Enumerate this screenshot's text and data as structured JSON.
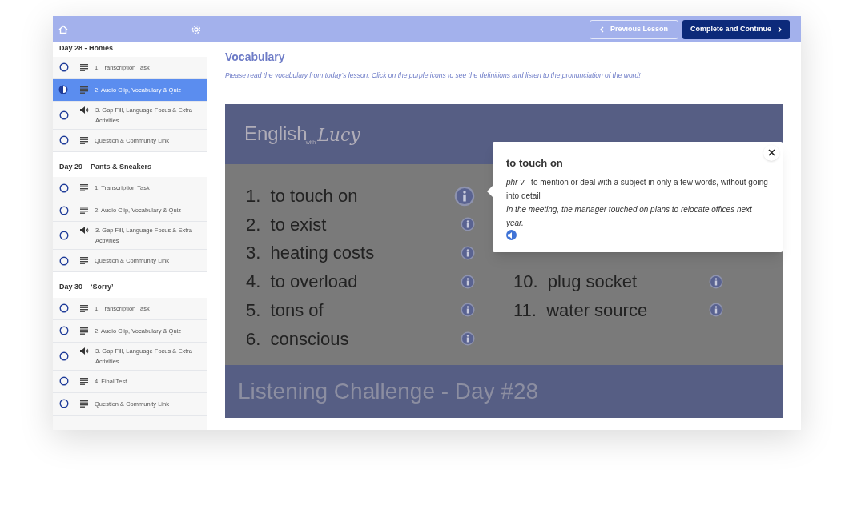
{
  "sections": [
    {
      "title": "Day 28 - Homes",
      "lessons": [
        {
          "label": "1. Transcription Task",
          "kind": "text",
          "level": 0,
          "selected": false
        },
        {
          "label": "2. Audio Clip, Vocabulary & Quiz",
          "kind": "text",
          "level": 0.5,
          "selected": true
        },
        {
          "label": "3. Gap Fill, Language Focus & Extra Activities",
          "kind": "audio",
          "level": 0,
          "selected": false
        },
        {
          "label": "Question & Community Link",
          "kind": "text",
          "level": 0,
          "selected": false
        }
      ]
    },
    {
      "title": "Day 29 – Pants & Sneakers",
      "lessons": [
        {
          "label": "1. Transcription Task",
          "kind": "text",
          "level": 0,
          "selected": false
        },
        {
          "label": "2. Audio Clip, Vocabulary & Quiz",
          "kind": "text",
          "level": 0,
          "selected": false
        },
        {
          "label": "3. Gap Fill, Language Focus & Extra Activities",
          "kind": "audio",
          "level": 0,
          "selected": false
        },
        {
          "label": "Question & Community Link",
          "kind": "text",
          "level": 0,
          "selected": false
        }
      ]
    },
    {
      "title": "Day 30 – ‘Sorry’",
      "lessons": [
        {
          "label": "1. Transcription Task",
          "kind": "text",
          "level": 0,
          "selected": false
        },
        {
          "label": "2. Audio Clip, Vocabulary & Quiz",
          "kind": "text",
          "level": 0,
          "selected": false
        },
        {
          "label": "3. Gap Fill, Language Focus & Extra Activities",
          "kind": "audio",
          "level": 0,
          "selected": false
        },
        {
          "label": "4. Final Test",
          "kind": "text",
          "level": 0,
          "selected": false
        },
        {
          "label": "Question & Community Link",
          "kind": "text",
          "level": 0,
          "selected": false
        }
      ]
    }
  ],
  "top_bar": {
    "previous_button": "Previous Lesson",
    "complete_button": "Complete and Continue"
  },
  "content": {
    "heading": "Vocabulary",
    "instructions": "Please read the vocabulary from today's lesson. Click on the purple icons to see the definitions and listen to the pronunciation of the word!",
    "slide": {
      "logo": "English",
      "logo_small": "with",
      "logo_script": "Lucy",
      "left_words": [
        {
          "number": "1.",
          "word": "to touch on"
        },
        {
          "number": "2.",
          "word": "to exist"
        },
        {
          "number": "3.",
          "word": "heating costs"
        },
        {
          "number": "4.",
          "word": "to overload"
        },
        {
          "number": "5.",
          "word": "tons of"
        },
        {
          "number": "6.",
          "word": "conscious"
        }
      ],
      "right_words": [
        {
          "number": "10.",
          "word": "plug socket"
        },
        {
          "number": "11.",
          "word": "water source"
        }
      ],
      "footer": "Listening Challenge - Day #28"
    },
    "popup": {
      "term": "to touch on",
      "definition": "*phr v* - to mention or deal with a subject in only a few words, without going into detail",
      "example": "In the meeting, the manager touched on plans to relocate offices next year."
    }
  }
}
